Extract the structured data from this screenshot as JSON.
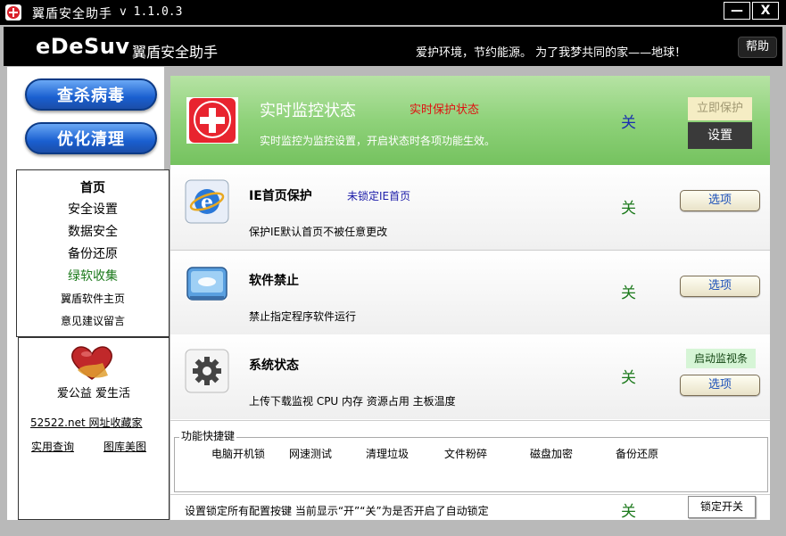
{
  "window": {
    "title": "翼盾安全助手",
    "version": "v 1.1.0.3",
    "minimize_label": "—",
    "close_label": "X"
  },
  "header": {
    "brand": "eDeSuv",
    "brand_cn": "翼盾安全助手",
    "slogan": "爱护环境，节约能源。 为了我梦共同的家——地球！",
    "help_label": "帮助"
  },
  "sidebar": {
    "scan_button": "查杀病毒",
    "optimize_button": "优化清理",
    "nav": [
      {
        "label": "首页"
      },
      {
        "label": "安全设置"
      },
      {
        "label": "数据安全"
      },
      {
        "label": "备份还原"
      },
      {
        "label": "绿软收集"
      },
      {
        "label": "翼盾软件主页"
      },
      {
        "label": "意见建议留言"
      }
    ],
    "promo": {
      "slogan": "爱公益 爱生活",
      "link1": "52522.net 网址收藏家",
      "link2": "实用查询",
      "link3": "图库美图"
    }
  },
  "main": {
    "monitor": {
      "title": "实时监控状态",
      "status": "实时保护状态",
      "desc": "实时监控为监控设置，开启状态时各项功能生效。",
      "state": "关",
      "protect_button": "立即保护",
      "setting_button": "设置"
    },
    "ie": {
      "title": "IE首页保护",
      "sub": "未锁定IE首页",
      "desc": "保护IE默认首页不被任意更改",
      "state": "关",
      "option_button": "选项"
    },
    "soft": {
      "title": "软件禁止",
      "desc": "禁止指定程序软件运行",
      "state": "关",
      "option_button": "选项"
    },
    "sys": {
      "title": "系统状态",
      "desc": "上传下载监视 CPU 内存 资源占用 主板温度",
      "state": "关",
      "monitor_bar_button": "启动监视条",
      "option_button": "选项"
    },
    "quick": {
      "label": "功能快捷键",
      "items": [
        "电脑开机锁",
        "网速测试",
        "清理垃圾",
        "文件粉碎",
        "磁盘加密",
        "备份还原"
      ]
    },
    "lockbar": {
      "text": "设置锁定所有配置按键 当前显示“开”“关”为是否开启了自动锁定",
      "state": "关",
      "button": "锁定开关"
    }
  }
}
